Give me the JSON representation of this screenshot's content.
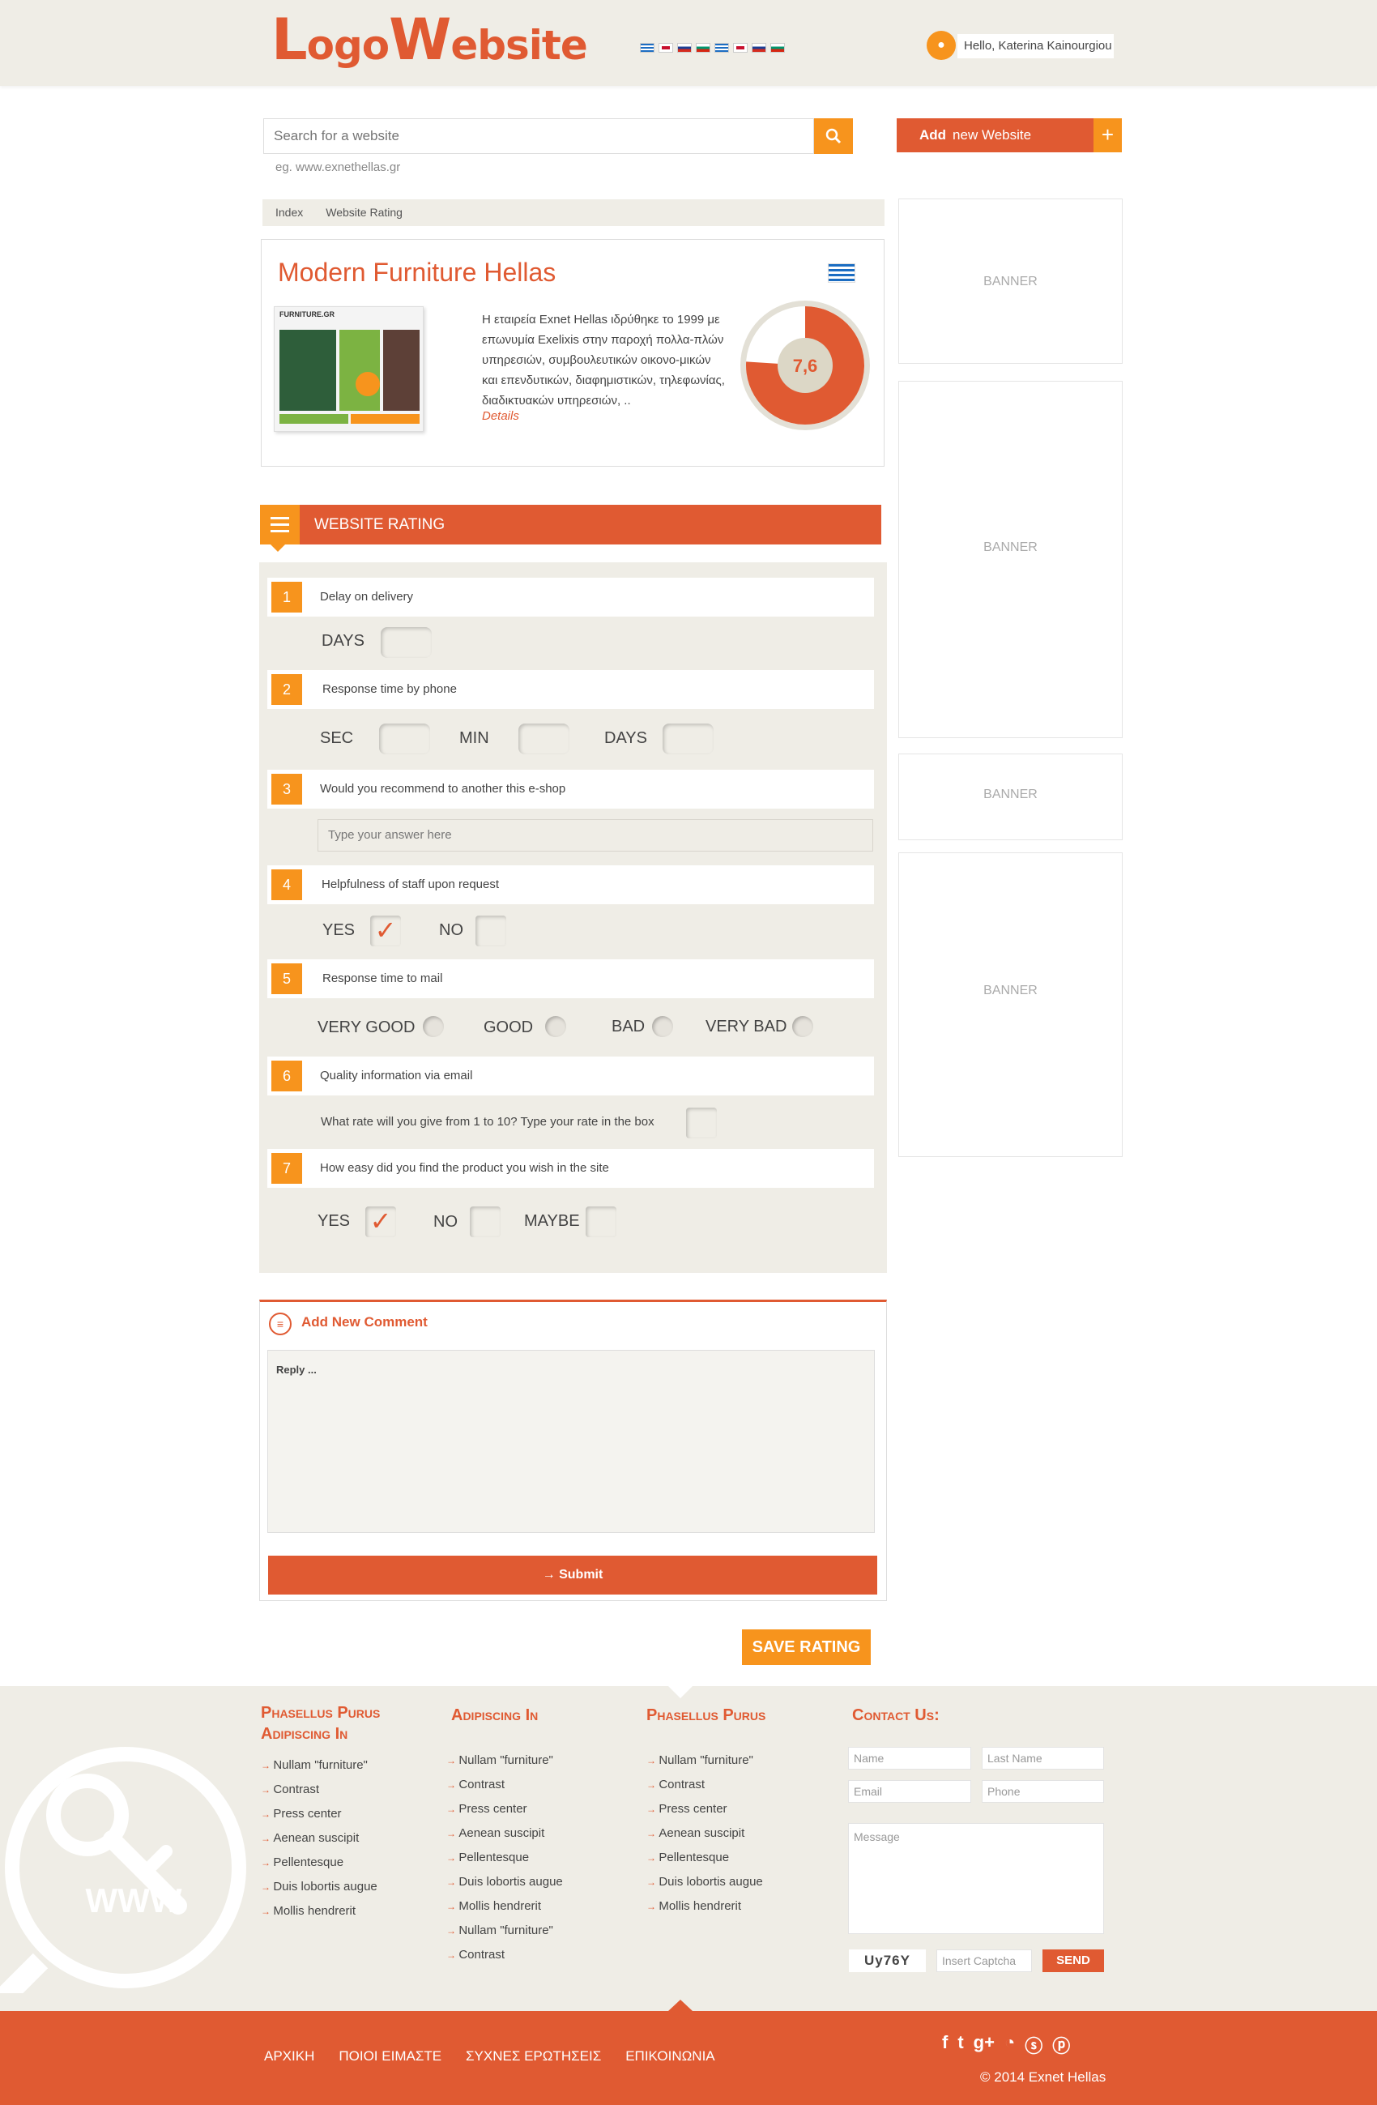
{
  "header": {
    "logo_part1": "L",
    "logo_part2": "ogo",
    "logo_part3": "W",
    "logo_part4": "ebsite",
    "user_greeting": "Hello, Katerina Kainourgiou"
  },
  "search": {
    "placeholder": "Search for a website",
    "example": "eg. www.exnethellas.gr",
    "add_bold": "Add",
    "add_label": "new Website",
    "add_plus": "+"
  },
  "breadcrumb": [
    "Index",
    "Website Rating"
  ],
  "site": {
    "title": "Modern Furniture Hellas",
    "description": "Η εταιρεία Exnet Hellas ιδρύθηκε το 1999 με επωνυμία Exelixis στην  παροχή πολλα-πλών υπηρεσιών, συμβουλευτικών οικονο-μικών και επενδυτικών, διαφημιστικών, τηλεφωνίας, διαδικτυακών υπηρεσιών, ..",
    "details_link": "Details",
    "rating": "7,6",
    "rating_value": 7.6,
    "thumb_brand": "FURNITURE.GR"
  },
  "banners": [
    "BANNER",
    "BANNER",
    "BANNER",
    "BANNER"
  ],
  "rating_section": {
    "title": "WEBSITE RATING",
    "questions": [
      {
        "num": "1",
        "text": "Delay on delivery"
      },
      {
        "num": "2",
        "text": "Response time by phone"
      },
      {
        "num": "3",
        "text": "Would you recommend to another this e-shop"
      },
      {
        "num": "4",
        "text": "Helpfulness of staff upon request"
      },
      {
        "num": "5",
        "text": "Response time to mail"
      },
      {
        "num": "6",
        "text": "Quality information via email"
      },
      {
        "num": "7",
        "text": "How easy did you find the product you wish in the site"
      }
    ],
    "labels": {
      "days": "DAYS",
      "sec": "SEC",
      "min": "MIN",
      "yes": "YES",
      "no": "NO",
      "maybe": "MAYBE",
      "very_good": "VERY GOOD",
      "good": "GOOD",
      "bad": "BAD",
      "very_bad": "VERY BAD",
      "rate_prompt": "What rate will you give from 1 to 10?  Type your rate in the box"
    },
    "answer_placeholder": "Type your answer here",
    "check_mark": "✓"
  },
  "comment": {
    "title": "Add New Comment",
    "reply_placeholder": "Reply ...",
    "submit": "→  Submit"
  },
  "save_label": "SAVE RATING",
  "footer": {
    "col1": {
      "title": "Phasellus Purus Adipiscing In",
      "items": [
        "Nullam \"furniture\"",
        "Contrast",
        "Press center",
        "Aenean suscipit",
        "Pellentesque",
        "Duis lobortis augue",
        "Mollis hendrerit"
      ]
    },
    "col2": {
      "title": "Adipiscing In",
      "items": [
        "Nullam \"furniture\"",
        "Contrast",
        "Press center",
        "Aenean suscipit",
        "Pellentesque",
        "Duis lobortis augue",
        "Mollis hendrerit",
        "Nullam \"furniture\"",
        "Contrast"
      ]
    },
    "col3": {
      "title": "Phasellus Purus",
      "items": [
        "Nullam \"furniture\"",
        "Contrast",
        "Press center",
        "Aenean suscipit",
        "Pellentesque",
        "Duis lobortis augue",
        "Mollis hendrerit"
      ]
    },
    "contact": {
      "title": "Contact Us:",
      "name": "Name",
      "last_name": "Last Name",
      "email": "Email",
      "phone": "Phone",
      "message": "Message",
      "captcha": "Uy76Y",
      "captcha_placeholder": "Insert Captcha",
      "send": "SEND"
    },
    "watermark": "WWW"
  },
  "bottom": {
    "nav": [
      "ΑΡΧΙΚΗ",
      "ΠΟΙΟΙ ΕΙΜΑΣΤΕ",
      "ΣΥΧΝΕΣ ΕΡΩΤΗΣΕΙΣ",
      "ΕΠΙΚΟΙΝΩΝΙΑ"
    ],
    "copyright": "© 2014 Exnet Hellas"
  },
  "colors": {
    "accent": "#e05a32",
    "secondary": "#f7941d",
    "background": "#efede6"
  }
}
